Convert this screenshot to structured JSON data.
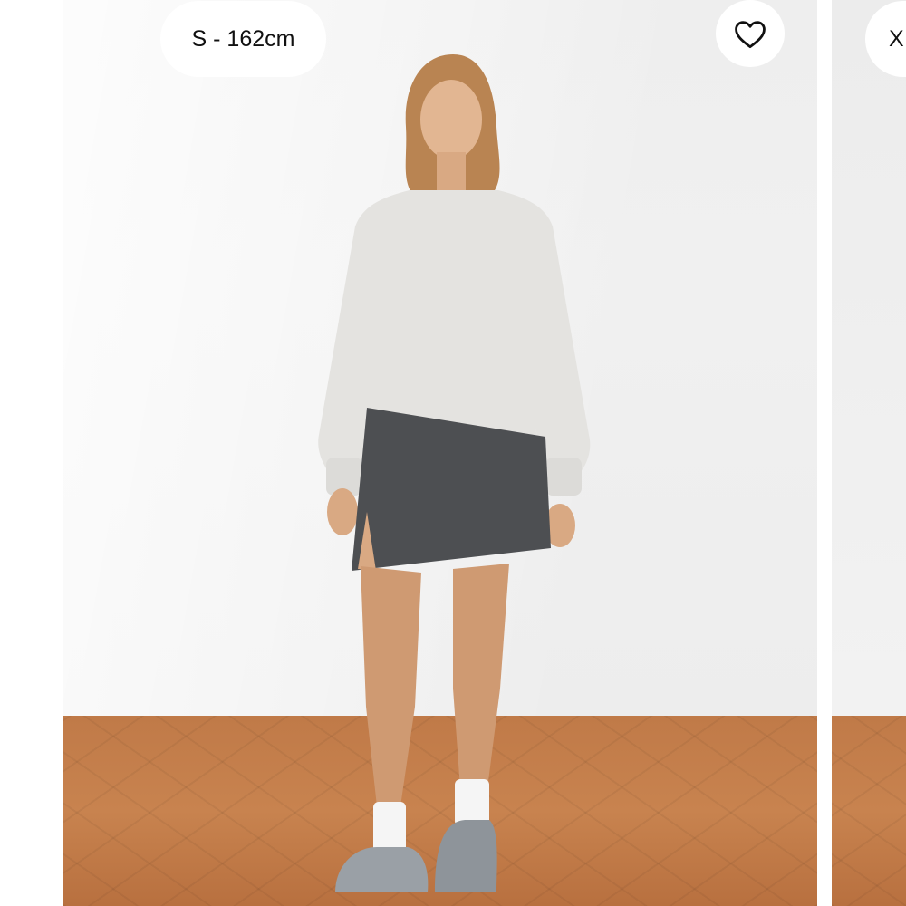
{
  "current_slide": {
    "size_label": "S - 162cm",
    "favorite_icon": "heart-outline-icon"
  },
  "next_slide": {
    "size_label_partial": "X"
  },
  "colors": {
    "pill_background": "#ffffff",
    "text": "#111111",
    "wall": "#eeeeee",
    "floor": "#c07a48",
    "sweater": "#e4e3e0",
    "skirt": "#4d4f52"
  }
}
